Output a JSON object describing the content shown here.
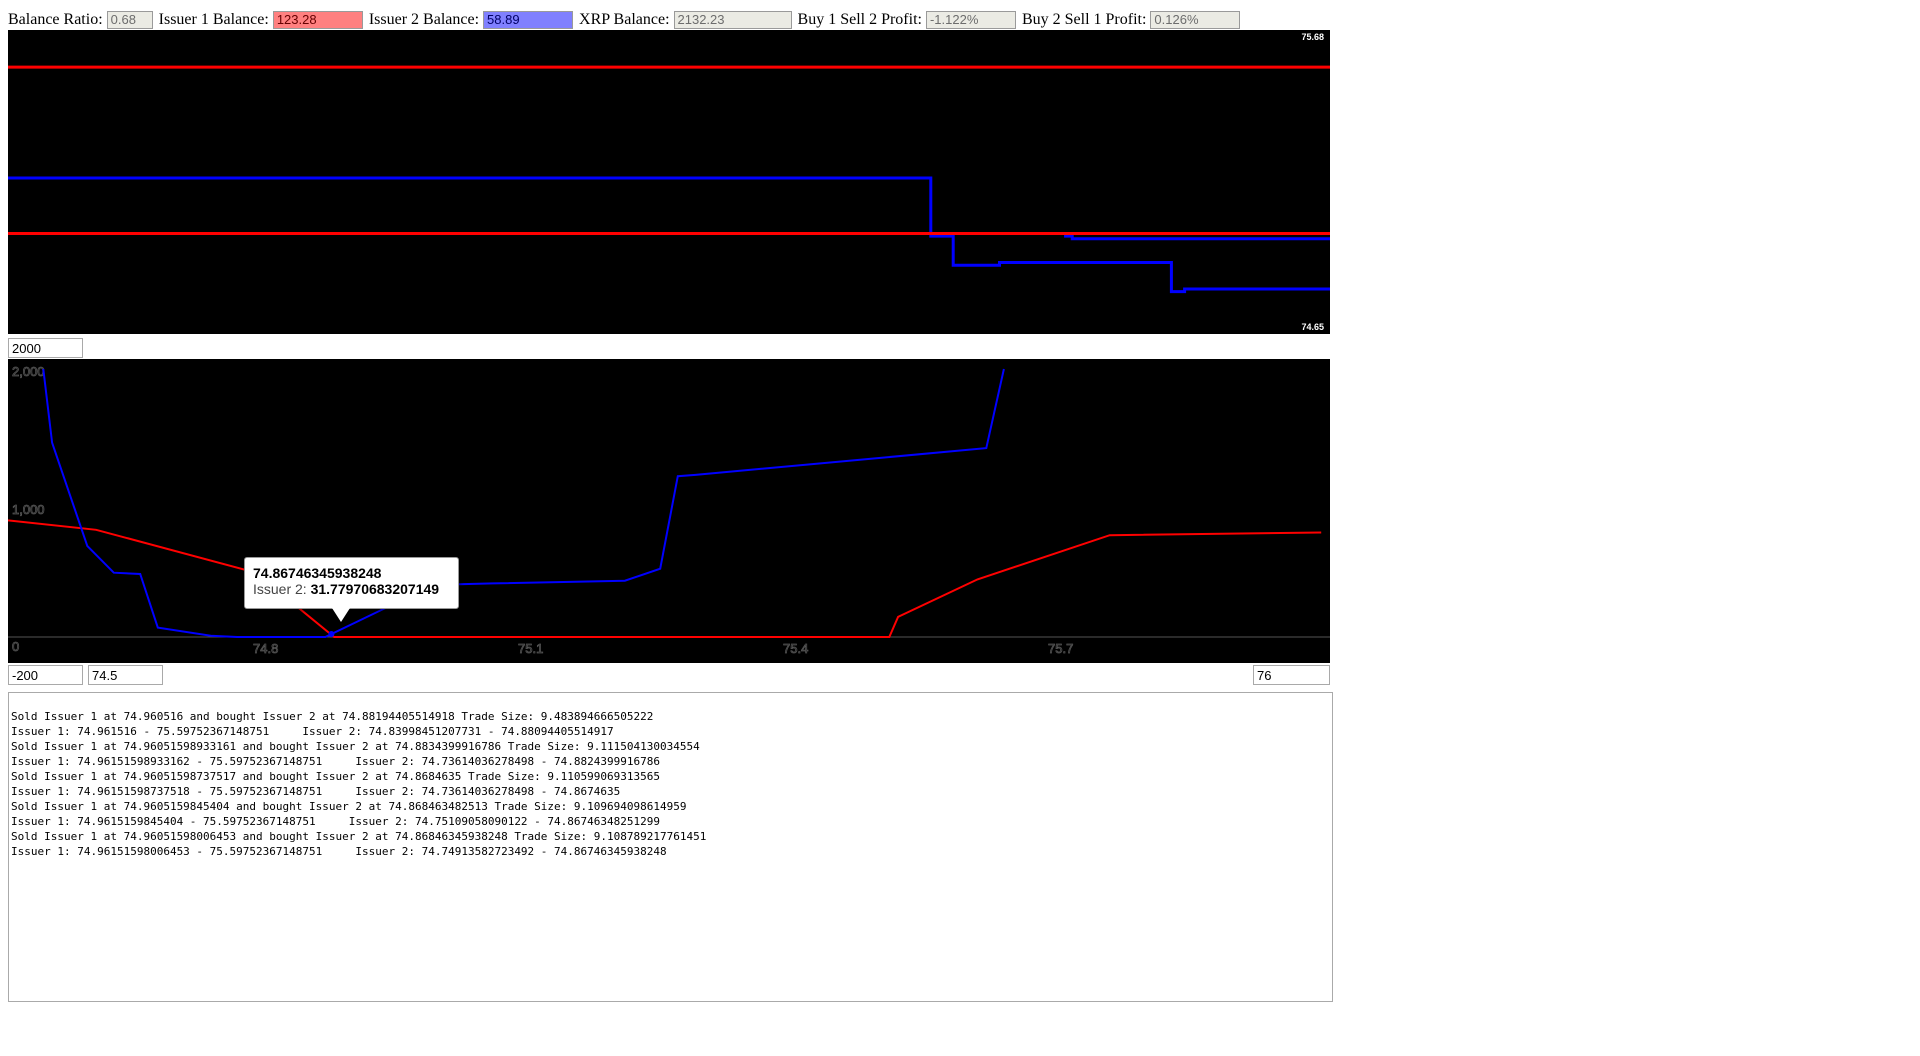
{
  "topbar": {
    "balance_ratio_label": "Balance Ratio:",
    "balance_ratio_value": "0.68",
    "issuer1_label": "Issuer 1 Balance:",
    "issuer1_value": "123.28",
    "issuer1_color": "#ff8080",
    "issuer2_label": "Issuer 2 Balance:",
    "issuer2_value": "58.89",
    "issuer2_color": "#8080ff",
    "xrp_label": "XRP Balance:",
    "xrp_value": "2132.23",
    "buy1sell2_label": "Buy 1 Sell 2 Profit:",
    "buy1sell2_value": "-1.122%",
    "buy2sell1_label": "Buy 2 Sell 1 Profit:",
    "buy2sell1_value": "0.126%"
  },
  "colors": {
    "issuer1": "#ff0000",
    "issuer2": "#0000ff",
    "background": "#000000",
    "axis_text": "#555555"
  },
  "top_chart": {
    "max_label": "75.68",
    "min_label": "74.65"
  },
  "depth_limit_input": "2000",
  "bottom_chart": {
    "y_ticks": [
      "2,000",
      "1,000",
      "0"
    ],
    "x_ticks": [
      "74.8",
      "75.1",
      "75.4",
      "75.7"
    ]
  },
  "controls": {
    "y_min": "-200",
    "x_min": "74.5",
    "x_max": "76"
  },
  "tooltip": {
    "title": "74.86746345938248",
    "series": "Issuer 2: ",
    "value": "31.77970683207149"
  },
  "chart_data": [
    {
      "type": "line",
      "ylim": [
        74.65,
        75.68
      ],
      "series": [
        {
          "values": [
            75.6,
            75.6
          ]
        },
        {
          "values": [
            74.97,
            74.97
          ]
        },
        {
          "values": [
            75.18,
            75.18,
            74.96,
            74.96,
            74.85,
            74.85,
            74.86,
            74.86,
            74.75,
            74.75,
            74.76,
            74.76
          ]
        },
        {
          "values": [
            74.97,
            74.97,
            74.96,
            74.96,
            74.95,
            74.95
          ]
        }
      ]
    },
    {
      "type": "line",
      "xlim": [
        74.5,
        76.0
      ],
      "ylim": [
        -200,
        2000
      ],
      "series": [
        {
          "x": [
            74.5,
            74.6,
            74.77,
            74.82,
            74.87,
            75.5,
            75.51,
            75.6,
            75.75,
            75.99
          ],
          "y": [
            870,
            800,
            500,
            270,
            0,
            0,
            150,
            430,
            760,
            780
          ]
        },
        {
          "x": [
            74.54,
            74.55,
            74.59,
            74.62,
            74.65,
            74.67,
            74.73,
            74.76,
            74.86,
            74.98,
            74.99,
            75.05,
            75.2,
            75.24,
            75.26,
            75.28,
            75.61,
            75.63
          ],
          "y": [
            2000,
            1450,
            680,
            480,
            470,
            70,
            10,
            0,
            0,
            380,
            390,
            400,
            420,
            510,
            1200,
            1210,
            1410,
            2000
          ]
        }
      ]
    }
  ],
  "log_lines": [
    "Sold Issuer 1 at 74.960516 and bought Issuer 2 at 74.88194405514918 Trade Size: 9.483894666505222",
    "Issuer 1: 74.961516 - 75.59752367148751     Issuer 2: 74.83998451207731 - 74.88094405514917",
    "Sold Issuer 1 at 74.96051598933161 and bought Issuer 2 at 74.8834399916786 Trade Size: 9.111504130034554",
    "Issuer 1: 74.96151598933162 - 75.59752367148751     Issuer 2: 74.73614036278498 - 74.8824399916786",
    "Sold Issuer 1 at 74.96051598737517 and bought Issuer 2 at 74.8684635 Trade Size: 9.110599069313565",
    "Issuer 1: 74.96151598737518 - 75.59752367148751     Issuer 2: 74.73614036278498 - 74.8674635",
    "Sold Issuer 1 at 74.9605159845404 and bought Issuer 2 at 74.868463482513 Trade Size: 9.109694098614959",
    "Issuer 1: 74.9615159845404 - 75.59752367148751     Issuer 2: 74.75109058090122 - 74.86746348251299",
    "Sold Issuer 1 at 74.96051598006453 and bought Issuer 2 at 74.86846345938248 Trade Size: 9.108789217761451",
    "Issuer 1: 74.96151598006453 - 75.59752367148751     Issuer 2: 74.74913582723492 - 74.86746345938248"
  ]
}
